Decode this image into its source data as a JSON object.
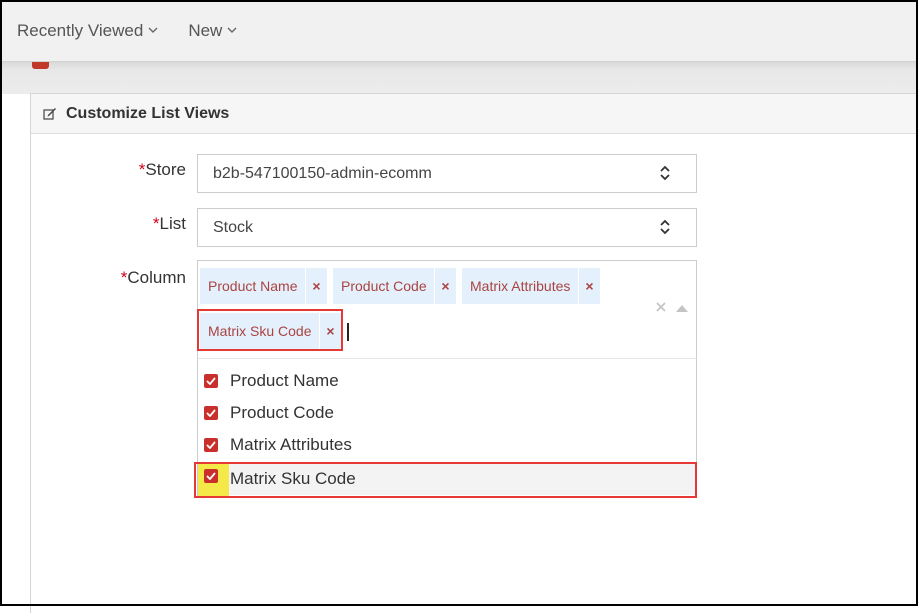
{
  "nav": {
    "recently_viewed": "Recently Viewed",
    "new": "New"
  },
  "panel": {
    "title": "Customize List Views"
  },
  "form": {
    "required_mark": "*",
    "store": {
      "label": "Store",
      "value": "b2b-547100150-admin-ecomm"
    },
    "list": {
      "label": "List",
      "value": "Stock"
    },
    "column": {
      "label": "Column",
      "tags": [
        "Product Name",
        "Product Code",
        "Matrix Attributes",
        "Matrix Sku Code"
      ],
      "tag_remove_glyph": "×"
    }
  },
  "dropdown": {
    "options": [
      {
        "label": "Product Name",
        "checked": true
      },
      {
        "label": "Product Code",
        "checked": true
      },
      {
        "label": "Matrix Attributes",
        "checked": true
      },
      {
        "label": "Matrix Sku Code",
        "checked": true
      }
    ]
  },
  "colors": {
    "accent_red": "#c9302c",
    "tag_bg": "#e4f0fb",
    "tag_text": "#a94442",
    "highlight_red": "#e53935",
    "highlight_yellow": "#f5e94a"
  }
}
